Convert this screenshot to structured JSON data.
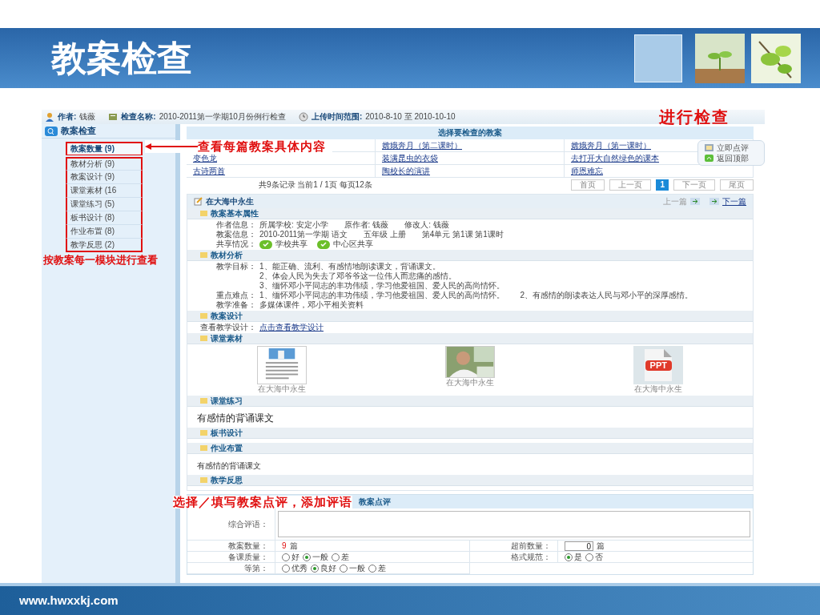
{
  "slide": {
    "title": "教案检查",
    "footer": "www.hwxxkj.com"
  },
  "info_bar": [
    {
      "kind": "author",
      "label": "作者:",
      "value": "钱薇"
    },
    {
      "kind": "check",
      "label": "检查名称:",
      "value": "2010-2011第一学期10月份例行检查"
    },
    {
      "kind": "time",
      "label": "上传时间范围:",
      "value": "2010-8-10 至 2010-10-10"
    }
  ],
  "callouts": {
    "check": "进行检查",
    "content": "查看每篇教案具体内容",
    "modules": "按教案每一模块进行查看",
    "review": "选择／填写教案点评，添加评语"
  },
  "sidebar": {
    "title": "教案检查",
    "items": [
      {
        "label": "教案数量 (9)",
        "selected": true
      },
      {
        "label": "教材分析 (9)",
        "selected": false
      },
      {
        "label": "教案设计 (9)",
        "selected": false
      },
      {
        "label": "课堂素材 (16",
        "selected": false
      },
      {
        "label": "课堂练习 (5)",
        "selected": false
      },
      {
        "label": "板书设计 (8)",
        "selected": false
      },
      {
        "label": "作业布置 (8)",
        "selected": false
      },
      {
        "label": "教学反思 (2)",
        "selected": false
      }
    ]
  },
  "lesson_list": {
    "title": "选择要检查的教案",
    "rows": [
      {
        "cells": [
          "",
          "嫦娥奔月（第二课时）",
          "嫦娥奔月（第一课时）"
        ]
      },
      {
        "cells": [
          "变色龙",
          "装满昆虫的衣袋",
          "去打开大自然绿色的课本"
        ]
      },
      {
        "cells": [
          "古诗两首",
          "陶校长的演讲",
          "师恩难忘"
        ]
      }
    ]
  },
  "pagination": {
    "summary": "共9条记录 当前1 / 1页 每页12条",
    "pages": [
      {
        "label": "首页",
        "selected": false
      },
      {
        "label": "上一页",
        "selected": false
      },
      {
        "label": "1",
        "selected": true
      },
      {
        "label": "下一页",
        "selected": false
      },
      {
        "label": "尾页",
        "selected": false
      }
    ]
  },
  "float_menu": [
    {
      "kind": "comment",
      "label": "立即点评"
    },
    {
      "kind": "top",
      "label": "返回顶部"
    }
  ],
  "lesson": {
    "title": "在大海中永生",
    "prev": "上一篇",
    "next": "下一篇",
    "sections": [
      {
        "kind": "fields",
        "title": "教案基本属性",
        "rows": [
          {
            "label": "作者信息：",
            "values": [
              "所属学校: 安定小学",
              "原作者: 钱薇",
              "修改人: 钱薇"
            ]
          },
          {
            "label": "教案信息：",
            "values": [
              "2010-2011第一学期 语文",
              "五年级 上册",
              "第4单元 第1课 第1课时"
            ]
          },
          {
            "label": "共享情况：",
            "shares": [
              {
                "label": "学校共享",
                "checked": true
              },
              {
                "label": "中心区共享",
                "checked": true
              }
            ]
          }
        ]
      },
      {
        "kind": "fields",
        "title": "教材分析",
        "rows": [
          {
            "label": "教学目标：",
            "lines": [
              "1、能正确、流利、有感情地朗读课文，背诵课文。",
              "2、体会人民为失去了邓爷爷这一位伟人而悲痛的感情。",
              "3、缅怀邓小平同志的丰功伟绩，学习他爱祖国、爱人民的高尚情怀。"
            ]
          },
          {
            "label": "重点难点：",
            "values": [
              "1、缅怀邓小平同志的丰功伟绩，学习他爱祖国、爱人民的高尚情怀。",
              "2、有感情的朗读表达人民与邓小平的深厚感情。"
            ]
          },
          {
            "label": "教学准备：",
            "values": [
              "多媒体课件，邓小平相关资料"
            ]
          }
        ]
      },
      {
        "kind": "link",
        "title": "教案设计",
        "label": "查看教学设计：",
        "link": "点击查看教学设计"
      },
      {
        "kind": "materials",
        "title": "课堂素材",
        "items": [
          {
            "kind": "document",
            "caption": "在大海中永生"
          },
          {
            "caption": "在大海中永生"
          },
          {
            "kind": "ppt",
            "badge": "PPT",
            "caption": "在大海中永生"
          }
        ]
      },
      {
        "kind": "text",
        "title": "课堂练习",
        "text": "有感情的背诵课文",
        "large": true
      },
      {
        "kind": "text",
        "title": "板书设计"
      },
      {
        "kind": "text",
        "title": "作业布置",
        "text": "有感情的背诵课文",
        "large": false
      },
      {
        "kind": "text",
        "title": "教学反思"
      }
    ]
  },
  "review": {
    "title": "教案点评",
    "comment_label": "综合评语：",
    "count": {
      "label": "教案数量：",
      "value": "9",
      "unit": "篇"
    },
    "advance": {
      "label": "超前数量：",
      "value": "0",
      "unit": "篇"
    },
    "quality": {
      "label": "备课质量：",
      "options": [
        {
          "label": "好",
          "selected": false
        },
        {
          "label": "一般",
          "selected": true
        },
        {
          "label": "差",
          "selected": false
        }
      ]
    },
    "format": {
      "label": "格式规范：",
      "options": [
        {
          "label": "是",
          "selected": true
        },
        {
          "label": "否",
          "selected": false
        }
      ]
    },
    "grade": {
      "label": "等第：",
      "options": [
        {
          "label": "优秀",
          "selected": false
        },
        {
          "label": "良好",
          "selected": true
        },
        {
          "label": "一般",
          "selected": false
        },
        {
          "label": "差",
          "selected": false
        }
      ]
    }
  }
}
